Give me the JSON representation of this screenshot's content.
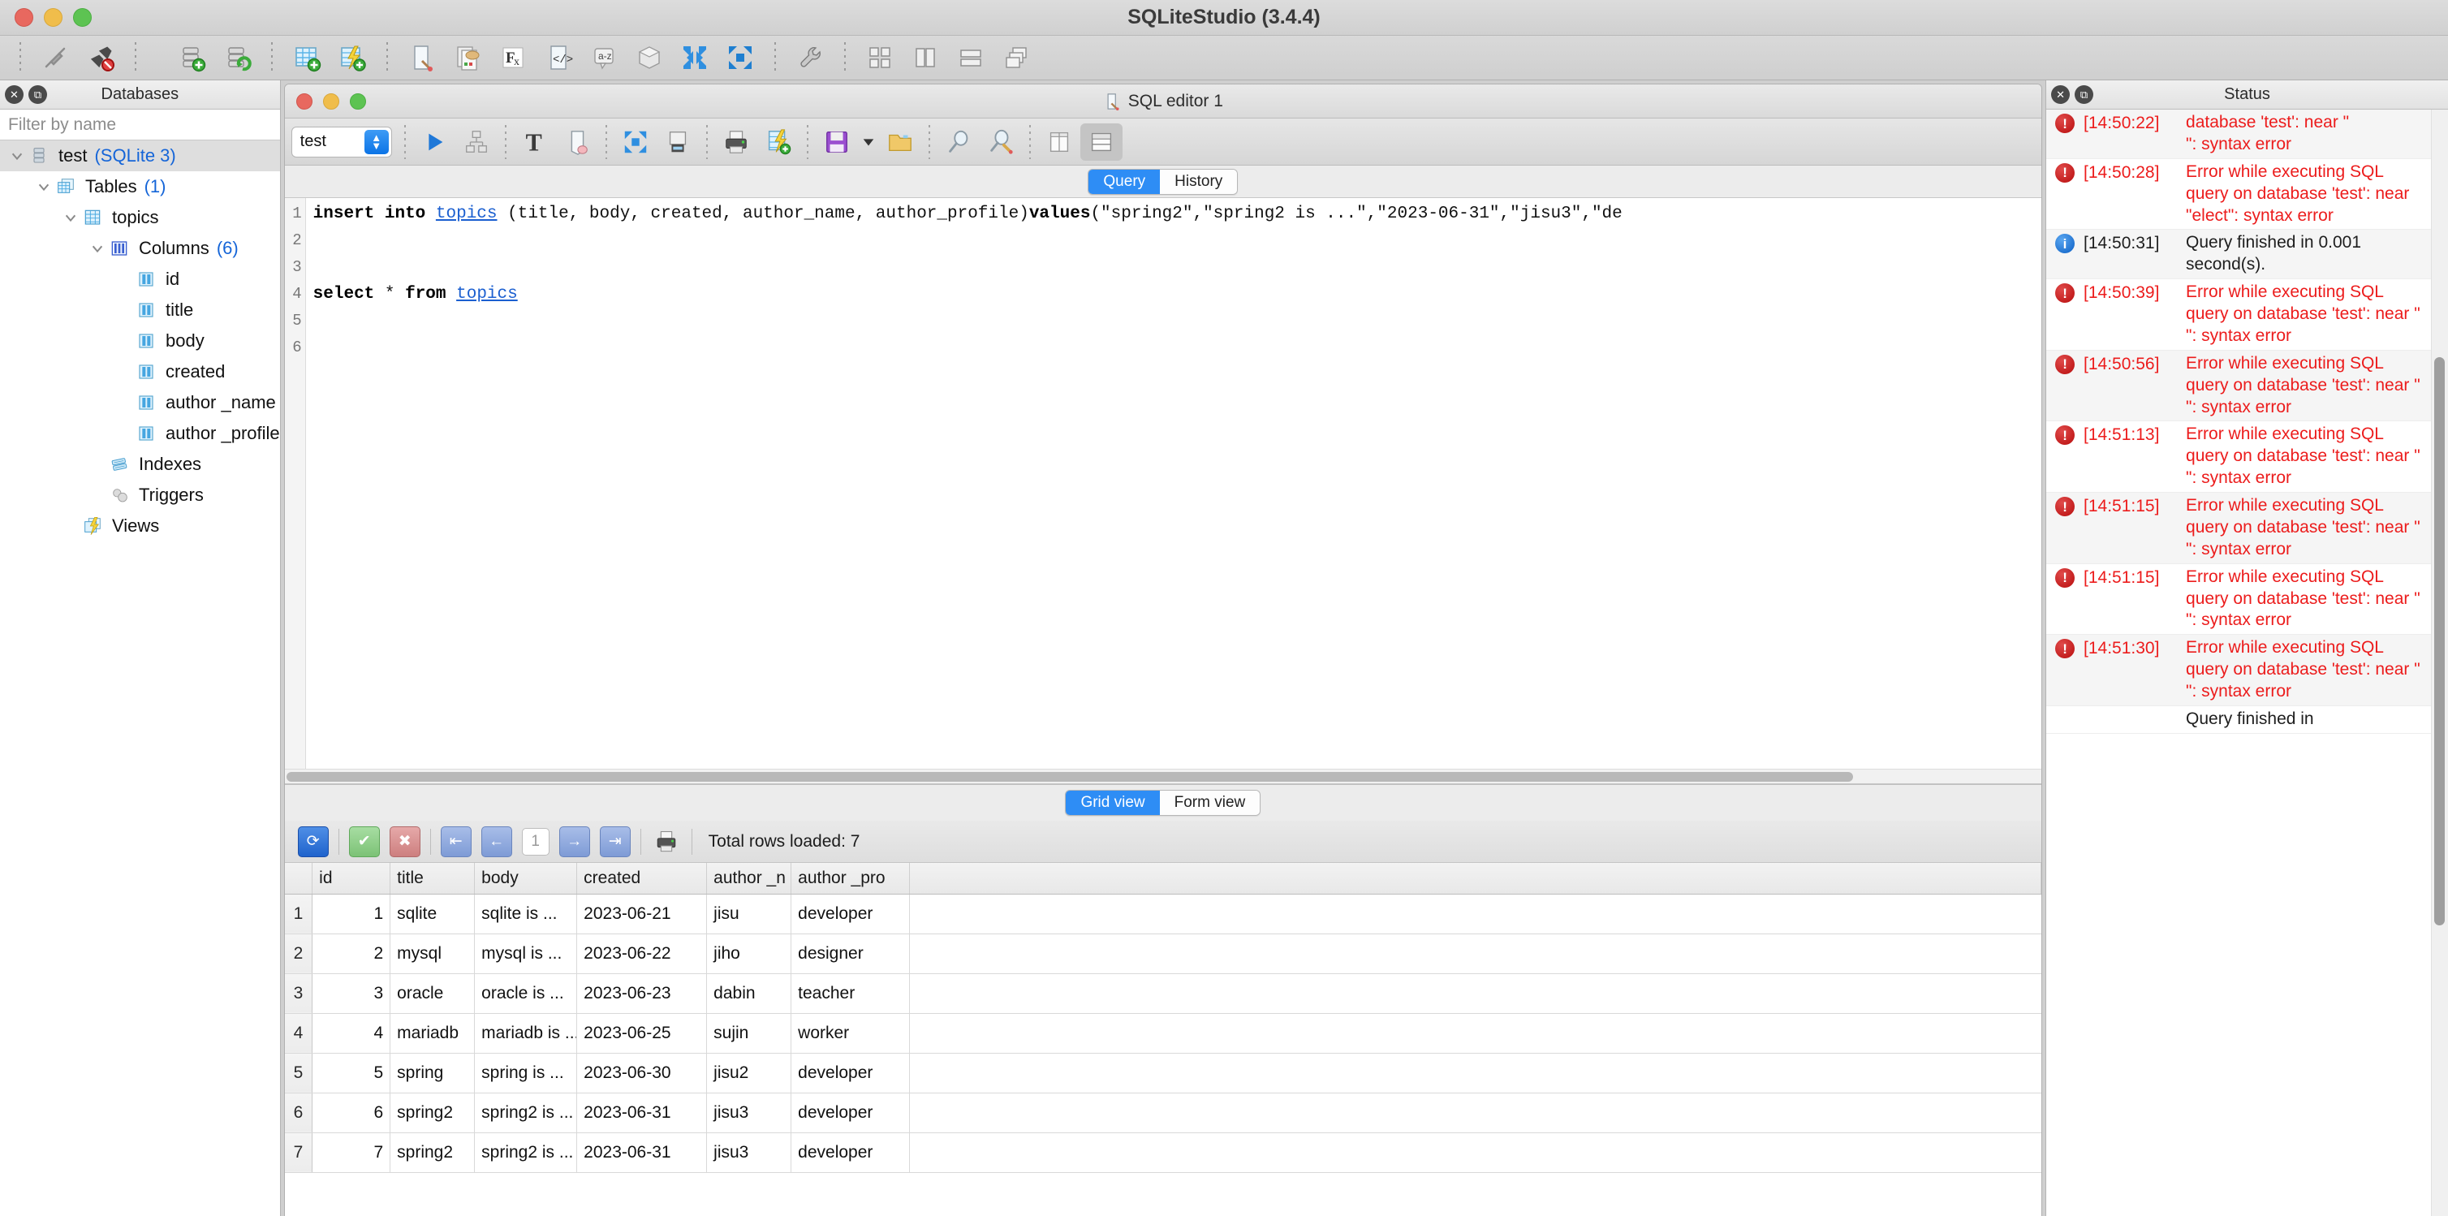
{
  "window": {
    "title": "SQLiteStudio (3.4.4)",
    "traffic": [
      "close",
      "minimize",
      "zoom"
    ]
  },
  "main_toolbar": {
    "buttons": [
      {
        "name": "connect-to-database",
        "icon": "plug-connect-icon"
      },
      {
        "name": "disconnect-from-database",
        "icon": "plug-disconnect-icon"
      },
      {
        "name": "add-database",
        "icon": "database-add-icon"
      },
      {
        "name": "edit-database",
        "icon": "database-refresh-icon"
      },
      {
        "name": "create-table",
        "icon": "table-add-icon"
      },
      {
        "name": "create-view",
        "icon": "view-add-icon"
      },
      {
        "name": "open-sql-editor",
        "icon": "sql-editor-icon"
      },
      {
        "name": "import-data",
        "icon": "import-icon"
      },
      {
        "name": "function-editor",
        "icon": "fx-icon"
      },
      {
        "name": "code-snippet",
        "icon": "code-icon"
      },
      {
        "name": "collation-editor",
        "icon": "az-sort-icon"
      },
      {
        "name": "extension-manager",
        "icon": "package-icon"
      },
      {
        "name": "collapse-all",
        "icon": "collapse-arrows-icon"
      },
      {
        "name": "expand-all",
        "icon": "expand-arrows-icon"
      },
      {
        "name": "configuration",
        "icon": "wrench-icon"
      },
      {
        "name": "tile-windows",
        "icon": "tile-grid-icon"
      },
      {
        "name": "tile-vertically",
        "icon": "tile-columns-icon"
      },
      {
        "name": "tile-horizontally",
        "icon": "tile-rows-icon"
      },
      {
        "name": "cascade-windows",
        "icon": "cascade-icon"
      }
    ]
  },
  "databases_dock": {
    "title": "Databases",
    "close_label": "✕",
    "float_label": "⧉",
    "filter": {
      "placeholder": "Filter by name",
      "value": ""
    },
    "tree": [
      {
        "indent": 0,
        "twisty": "down",
        "icon": "database-icon",
        "label": "test",
        "count": "(SQLite 3)",
        "selected": true
      },
      {
        "indent": 1,
        "twisty": "down",
        "icon": "tables-icon",
        "label": "Tables",
        "count": "(1)",
        "selected": false
      },
      {
        "indent": 2,
        "twisty": "down",
        "icon": "table-icon",
        "label": "topics",
        "count": "",
        "selected": false
      },
      {
        "indent": 3,
        "twisty": "down",
        "icon": "columns-icon",
        "label": "Columns",
        "count": "(6)",
        "selected": false
      },
      {
        "indent": 4,
        "twisty": "none",
        "icon": "column-icon",
        "label": "id",
        "count": "",
        "selected": false
      },
      {
        "indent": 4,
        "twisty": "none",
        "icon": "column-icon",
        "label": "title",
        "count": "",
        "selected": false
      },
      {
        "indent": 4,
        "twisty": "none",
        "icon": "column-icon",
        "label": "body",
        "count": "",
        "selected": false
      },
      {
        "indent": 4,
        "twisty": "none",
        "icon": "column-icon",
        "label": "created",
        "count": "",
        "selected": false
      },
      {
        "indent": 4,
        "twisty": "none",
        "icon": "column-icon",
        "label": "author _name",
        "count": "",
        "selected": false
      },
      {
        "indent": 4,
        "twisty": "none",
        "icon": "column-icon",
        "label": "author _profile",
        "count": "",
        "selected": false
      },
      {
        "indent": 3,
        "twisty": "none",
        "icon": "indexes-icon",
        "label": "Indexes",
        "count": "",
        "selected": false
      },
      {
        "indent": 3,
        "twisty": "none",
        "icon": "triggers-icon",
        "label": "Triggers",
        "count": "",
        "selected": false
      },
      {
        "indent": 2,
        "twisty": "none",
        "icon": "views-icon",
        "label": "Views",
        "count": "",
        "selected": false
      }
    ]
  },
  "sql_editor": {
    "window_title": "SQL editor 1",
    "window_icon": "sql-editor-icon",
    "database_combo": {
      "value": "test"
    },
    "toolbar_buttons": [
      {
        "name": "execute-query",
        "icon": "play-icon"
      },
      {
        "name": "explain-query-plan",
        "icon": "query-plan-icon"
      },
      {
        "name": "format-sql",
        "icon": "text-format-icon"
      },
      {
        "name": "clear-editor",
        "icon": "erase-icon"
      },
      {
        "name": "expand-results",
        "icon": "expand-arrows-icon"
      },
      {
        "name": "export-results",
        "icon": "export-icon"
      },
      {
        "name": "print-results",
        "icon": "print-icon"
      },
      {
        "name": "create-view-from-query",
        "icon": "view-add-icon"
      },
      {
        "name": "save-sql-file",
        "icon": "save-icon"
      },
      {
        "name": "save-dropdown",
        "icon": "chevron-down-icon"
      },
      {
        "name": "open-sql-file",
        "icon": "folder-open-icon"
      },
      {
        "name": "find-text",
        "icon": "magnifier-icon"
      },
      {
        "name": "find-and-replace",
        "icon": "magnifier-edit-icon"
      },
      {
        "name": "layout-side-by-side",
        "icon": "layout-columns-icon"
      },
      {
        "name": "layout-stacked",
        "icon": "layout-rows-icon"
      }
    ],
    "tabs": [
      {
        "label": "Query",
        "active": true
      },
      {
        "label": "History",
        "active": false
      }
    ],
    "code_lines": [
      {
        "no": "1",
        "tokens": [
          {
            "t": "insert into ",
            "c": "kw"
          },
          {
            "t": "topics",
            "c": "tbl"
          },
          {
            "t": " (title, body, created, author_name, author_profile)",
            "c": ""
          },
          {
            "t": "values",
            "c": "kw"
          },
          {
            "t": "(\"spring2\",\"spring2 is ...\",\"2023-06-31\",\"jisu3\",\"de",
            "c": ""
          }
        ]
      },
      {
        "no": "2",
        "tokens": []
      },
      {
        "no": "3",
        "tokens": []
      },
      {
        "no": "4",
        "tokens": [
          {
            "t": "select ",
            "c": "kw"
          },
          {
            "t": "* ",
            "c": ""
          },
          {
            "t": "from ",
            "c": "kw"
          },
          {
            "t": "topics",
            "c": "tbl"
          }
        ]
      },
      {
        "no": "5",
        "tokens": []
      },
      {
        "no": "6",
        "tokens": []
      }
    ]
  },
  "results": {
    "view_tabs": [
      {
        "label": "Grid view",
        "active": true
      },
      {
        "label": "Form view",
        "active": false
      }
    ],
    "toolbar": [
      {
        "name": "refresh-data-button",
        "icon": "refresh-icon",
        "glyph": "⟳",
        "color": "#2f6fd0"
      },
      {
        "name": "commit-changes-button",
        "icon": "check-icon",
        "glyph": "✔",
        "color": "#7ec77a"
      },
      {
        "name": "rollback-changes-button",
        "icon": "cross-icon",
        "glyph": "✖",
        "color": "#d88c8c"
      },
      {
        "name": "first-page-button",
        "icon": "first-page-icon",
        "glyph": "⇤",
        "color": "#8da6d8"
      },
      {
        "name": "previous-page-button",
        "icon": "previous-page-icon",
        "glyph": "←",
        "color": "#8da6d8"
      },
      {
        "name": "next-page-button",
        "icon": "next-page-icon",
        "glyph": "→",
        "color": "#8da6d8"
      },
      {
        "name": "last-page-button",
        "icon": "last-page-icon",
        "glyph": "⇥",
        "color": "#8da6d8"
      },
      {
        "name": "print-results-button",
        "icon": "print-icon",
        "glyph": "",
        "color": "transparent"
      }
    ],
    "page_number": "1",
    "rows_loaded_label": "Total rows loaded: 7",
    "columns": [
      "id",
      "title",
      "body",
      "created",
      "author _n",
      "author _pro"
    ],
    "rows": [
      {
        "n": "1",
        "cells": [
          "1",
          "sqlite",
          "sqlite is ...",
          "2023-06-21",
          "jisu",
          "developer"
        ]
      },
      {
        "n": "2",
        "cells": [
          "2",
          "mysql",
          "mysql is ...",
          "2023-06-22",
          "jiho",
          "designer"
        ]
      },
      {
        "n": "3",
        "cells": [
          "3",
          "oracle",
          "oracle is ...",
          "2023-06-23",
          "dabin",
          "teacher"
        ]
      },
      {
        "n": "4",
        "cells": [
          "4",
          "mariadb",
          "mariadb is ...",
          "2023-06-25",
          "sujin",
          "worker"
        ]
      },
      {
        "n": "5",
        "cells": [
          "5",
          "spring",
          "spring is ...",
          "2023-06-30",
          "jisu2",
          "developer"
        ]
      },
      {
        "n": "6",
        "cells": [
          "6",
          "spring2",
          "spring2 is ...",
          "2023-06-31",
          "jisu3",
          "developer"
        ]
      },
      {
        "n": "7",
        "cells": [
          "7",
          "spring2",
          "spring2 is ...",
          "2023-06-31",
          "jisu3",
          "developer"
        ]
      }
    ]
  },
  "status_dock": {
    "title": "Status",
    "close_label": "✕",
    "float_label": "⧉",
    "entries": [
      {
        "level": "error",
        "time": "[14:50:22]",
        "message": "database 'test': near \"\n\": syntax error"
      },
      {
        "level": "error",
        "time": "[14:50:28]",
        "message": "Error while executing SQL query on database 'test': near \"elect\": syntax error"
      },
      {
        "level": "info",
        "time": "[14:50:31]",
        "message": "Query finished in 0.001 second(s)."
      },
      {
        "level": "error",
        "time": "[14:50:39]",
        "message": "Error while executing SQL query on database 'test': near \"\n\": syntax error"
      },
      {
        "level": "error",
        "time": "[14:50:56]",
        "message": "Error while executing SQL query on database 'test': near \"\n\": syntax error"
      },
      {
        "level": "error",
        "time": "[14:51:13]",
        "message": "Error while executing SQL query on database 'test': near \"\n\": syntax error"
      },
      {
        "level": "error",
        "time": "[14:51:15]",
        "message": "Error while executing SQL query on database 'test': near \"\n\": syntax error"
      },
      {
        "level": "error",
        "time": "[14:51:15]",
        "message": "Error while executing SQL query on database 'test': near \"\n\": syntax error"
      },
      {
        "level": "error",
        "time": "[14:51:30]",
        "message": "Error while executing SQL query on database 'test': near \"\n\": syntax error"
      },
      {
        "level": "info",
        "time": "",
        "message": "Query finished in"
      }
    ]
  },
  "colors": {
    "accent_blue": "#2e8df5",
    "error_red": "#ec1c1c",
    "link_blue": "#1565d8",
    "window_bg": "#d4d4d4"
  }
}
